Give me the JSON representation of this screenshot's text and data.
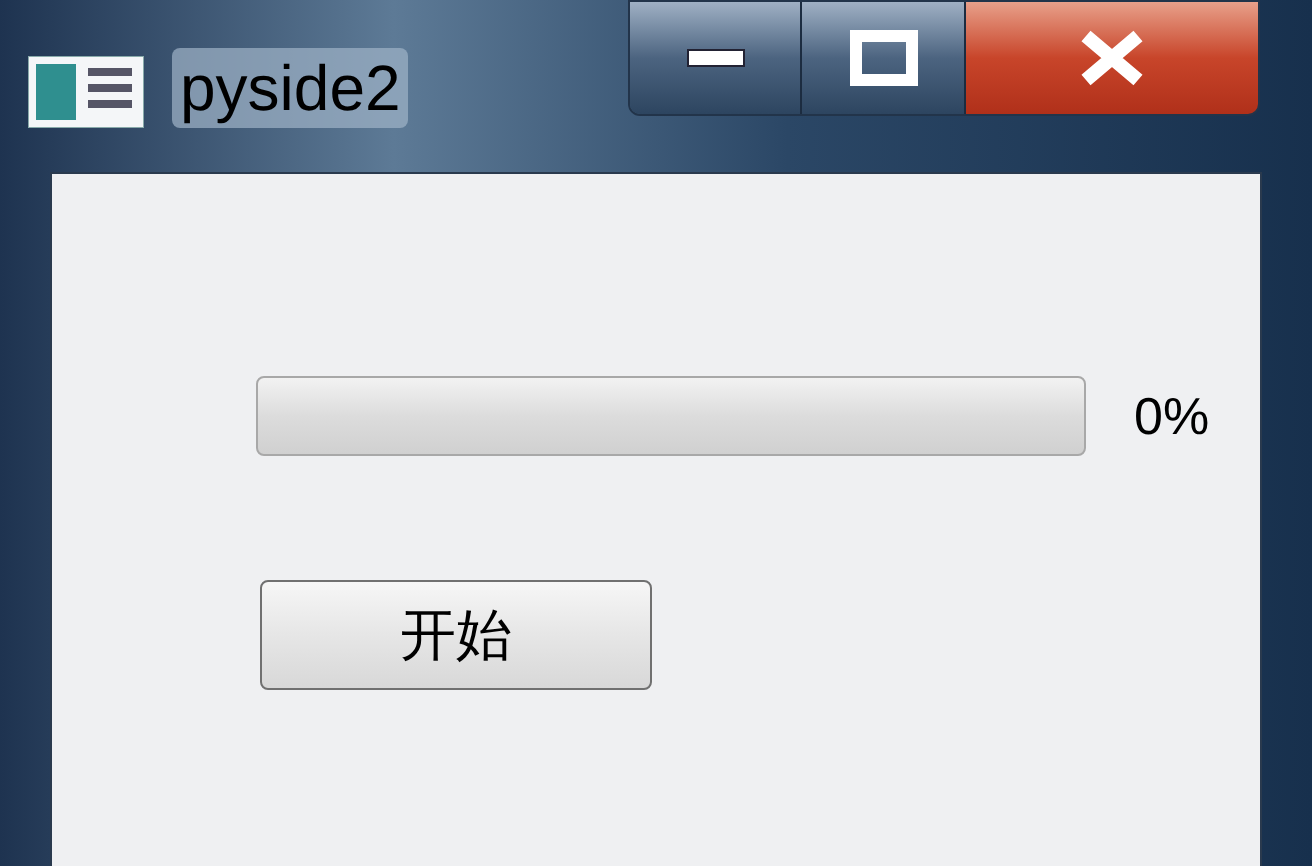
{
  "window": {
    "title": "pyside2"
  },
  "progress": {
    "level": 0,
    "reading": "0%"
  },
  "button": {
    "label": "开始"
  }
}
